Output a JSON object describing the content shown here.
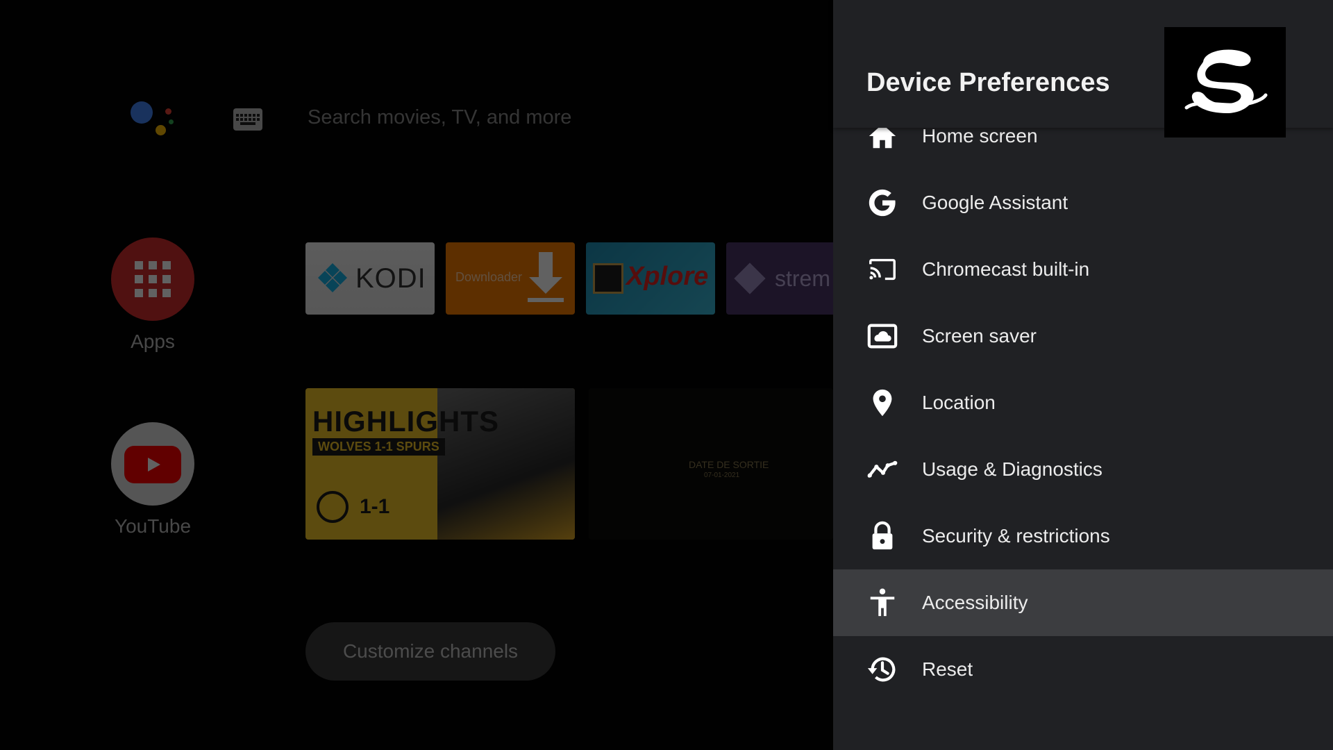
{
  "launcher": {
    "search_placeholder": "Search movies, TV, and more",
    "apps_label": "Apps",
    "youtube_label": "YouTube",
    "customize_label": "Customize channels",
    "cards": {
      "kodi": "KODI",
      "downloader": "Downloader",
      "xplore": "Xplore",
      "stremio": "strem"
    },
    "highlights": {
      "title": "HIGHLIGHTS",
      "subtitle": "WOLVES 1-1 SPURS",
      "score": "1-1"
    },
    "release": {
      "title": "DATE DE SORTIE",
      "date": "07-01-2021"
    }
  },
  "panel": {
    "title": "Device Preferences",
    "items": [
      {
        "label": "Home screen",
        "icon": "home-icon"
      },
      {
        "label": "Google Assistant",
        "icon": "google-g-icon"
      },
      {
        "label": "Chromecast built-in",
        "icon": "cast-icon"
      },
      {
        "label": "Screen saver",
        "icon": "screensaver-icon"
      },
      {
        "label": "Location",
        "icon": "location-pin-icon"
      },
      {
        "label": "Usage & Diagnostics",
        "icon": "diagnostics-icon"
      },
      {
        "label": "Security & restrictions",
        "icon": "lock-icon"
      },
      {
        "label": "Accessibility",
        "icon": "accessibility-icon",
        "focused": true
      },
      {
        "label": "Reset",
        "icon": "reset-icon"
      }
    ]
  },
  "colors": {
    "panel_bg": "#202124",
    "focus_bg": "#3c3d40",
    "apps_red": "#d32f2f",
    "youtube_red": "#ff0000"
  }
}
